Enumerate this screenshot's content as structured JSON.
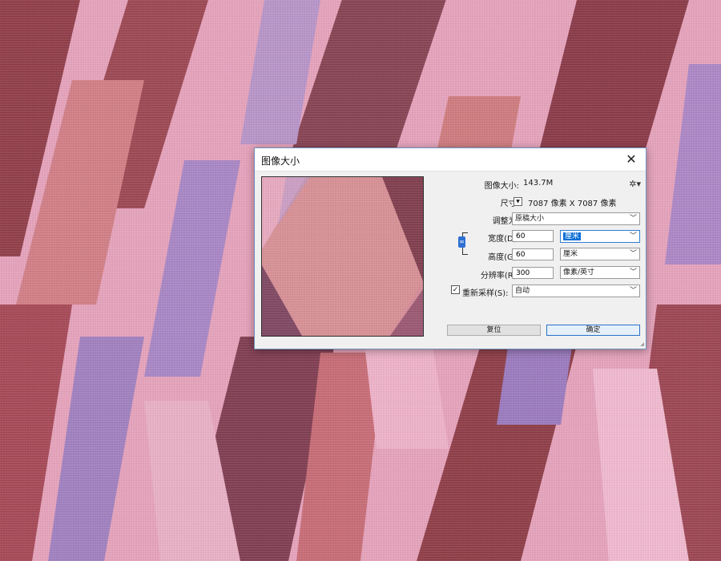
{
  "dialog": {
    "title": "图像大小",
    "close_icon": "close-icon",
    "image_size_label": "图像大小:",
    "image_size_value": "143.7M",
    "gear_icon": "gear-icon",
    "dimensions_label": "尺寸:",
    "dimensions_value": "7087 像素  X  7087 像素",
    "fit_to_label": "调整为:",
    "fit_to_value": "原稿大小",
    "width_label": "宽度(D):",
    "width_value": "60",
    "width_unit": "厘米",
    "height_label": "高度(G):",
    "height_value": "60",
    "height_unit": "厘米",
    "resolution_label": "分辨率(R):",
    "resolution_value": "300",
    "resolution_unit": "像素/英寸",
    "resample_label": "重新采样(S):",
    "resample_checked": true,
    "resample_value": "自动",
    "reset_button": "复位",
    "ok_button": "确定"
  },
  "colors": {
    "accent": "#2e6fd2",
    "background_pattern": [
      "#d98fab",
      "#8e3a44",
      "#a885c6",
      "#e9a3bd",
      "#cf7a7d"
    ]
  }
}
